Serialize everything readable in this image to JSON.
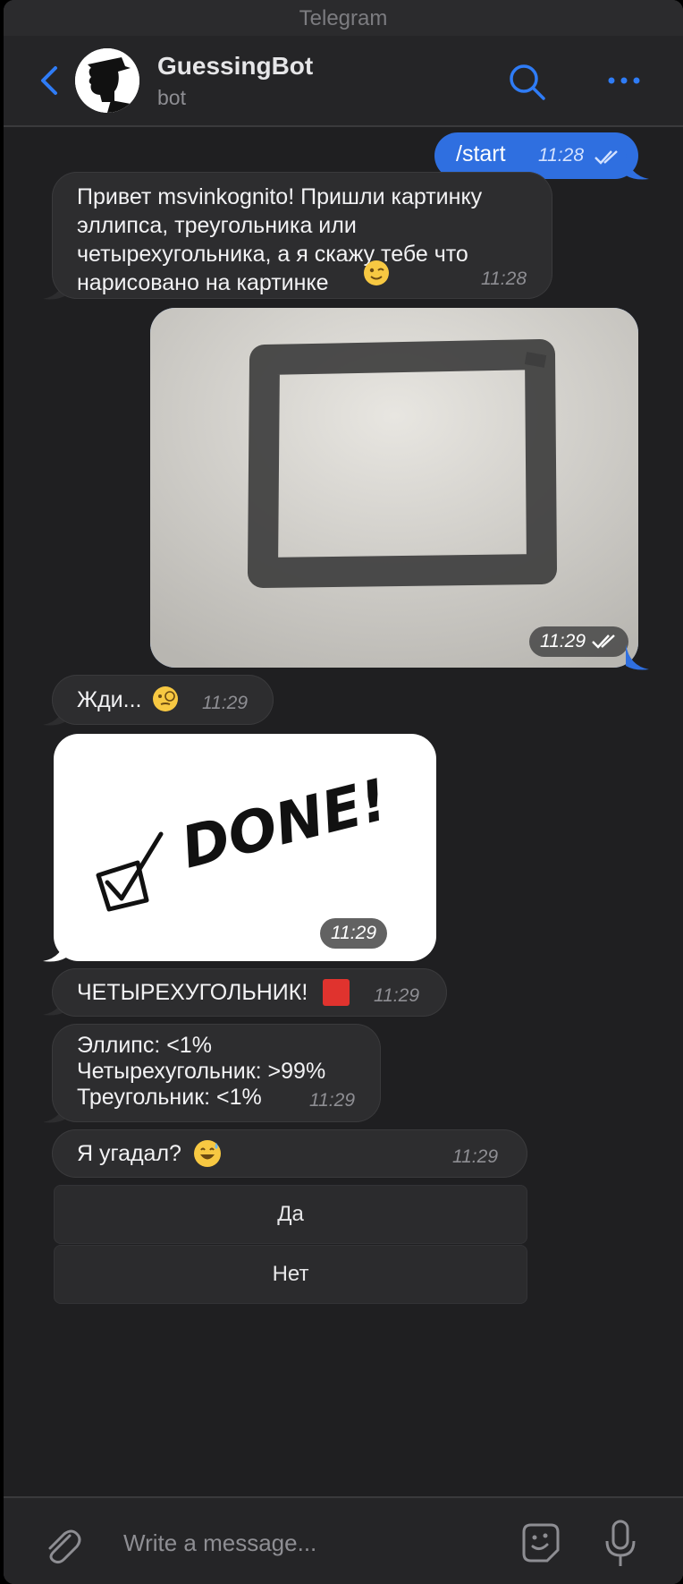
{
  "window": {
    "title": "Telegram"
  },
  "header": {
    "name": "GuessingBot",
    "subtitle": "bot"
  },
  "messages": {
    "m1": {
      "text": "/start",
      "time": "11:28"
    },
    "m2": {
      "text": "Привет msvinkognito! Пришли картинку\nэллипса, треугольника или\nчетырехугольника, а я скажу тебе что\nнарисовано на картинке",
      "time": "11:28",
      "emoji": "winking-face"
    },
    "m3": {
      "time": "11:29",
      "image": "hand-drawn-square-photo"
    },
    "m4": {
      "text": "Жди...",
      "time": "11:29",
      "emoji": "face-with-monocle"
    },
    "m5": {
      "time": "11:29",
      "image_text": "DONE!"
    },
    "m6": {
      "text": "ЧЕТЫРЕХУГОЛЬНИК!",
      "time": "11:29",
      "emoji": "red-square"
    },
    "m7": {
      "text": "Эллипс: <1%\nЧетырехугольник: >99%\nТреугольник: <1%",
      "time": "11:29"
    },
    "m8": {
      "text": "Я угадал?",
      "time": "11:29",
      "emoji": "grinning-sweat"
    }
  },
  "keyboard": {
    "yes": "Да",
    "no": "Нет"
  },
  "composer": {
    "placeholder": "Write a message..."
  },
  "colors": {
    "accent": "#2f6fe0",
    "bubble_in": "#2d2d2f",
    "background": "#1f1f21"
  }
}
